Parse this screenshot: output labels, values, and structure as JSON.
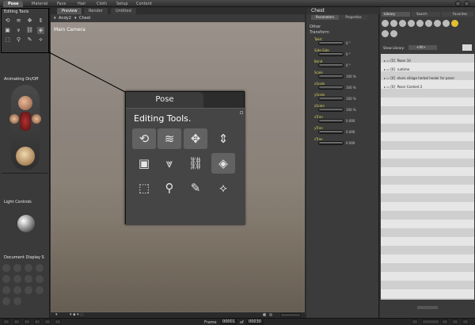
{
  "app": {
    "room_tabs": [
      "Pose",
      "Material",
      "Face",
      "Hair",
      "Cloth",
      "Setup",
      "Content"
    ],
    "active_room": "Pose"
  },
  "left_panel": {
    "editing_tools_title": "Editing Tools",
    "animating_title": "Animating On/Off",
    "light_controls_title": "Light Controls",
    "document_display_title": "Document Display S"
  },
  "viewport": {
    "tabs": [
      "Preview",
      "Render",
      "Untitled"
    ],
    "active_tab": "Preview",
    "figure_selector": "Andy2",
    "part_selector": "Chest",
    "camera_label": "Main Camera"
  },
  "popup": {
    "tab_label": "Pose",
    "title": "Editing Tools.",
    "icons": [
      "rotate-icon",
      "twist-icon",
      "translate-icon",
      "translate-in-out-icon",
      "scale-icon",
      "taper-icon",
      "chain-break-icon",
      "color-icon",
      "grouping-icon",
      "view-magnifier-icon",
      "morphing-tool-icon",
      "direct-manipulation-icon"
    ]
  },
  "parameters": {
    "header": "Chest",
    "tabs": [
      "Parameters",
      "Properties"
    ],
    "groups": [
      "Other",
      "Transform"
    ],
    "items": [
      {
        "label": "Twist",
        "value": "0 °"
      },
      {
        "label": "Side-Side",
        "value": "0 °"
      },
      {
        "label": "Bend",
        "value": "0 °"
      },
      {
        "label": "Scale",
        "value": "100 %"
      },
      {
        "label": "xScale",
        "value": "100 %"
      },
      {
        "label": "yScale",
        "value": "100 %"
      },
      {
        "label": "zScale",
        "value": "100 %"
      },
      {
        "label": "xTran",
        "value": "0.000"
      },
      {
        "label": "yTran",
        "value": "0.000"
      },
      {
        "label": "zTran",
        "value": "0.000"
      }
    ]
  },
  "library": {
    "tabs": [
      "Library",
      "Search",
      "Favorites"
    ],
    "show_library_label": "Show Library:",
    "show_library_value": "<All>",
    "rows": [
      {
        "count": "[5]",
        "name": "Poser 10"
      },
      {
        "count": "[0]",
        "name": "runtime"
      },
      {
        "count": "[0]",
        "name": "elven village herbal healer for poser"
      },
      {
        "count": "[0]",
        "name": "Poser Content 2"
      }
    ]
  },
  "bottom": {
    "frame_label": "Frame",
    "frame_value": "00001",
    "of_label": "of",
    "total_value": "00030"
  }
}
